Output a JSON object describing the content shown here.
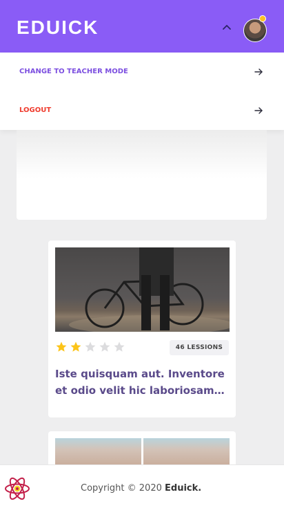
{
  "header": {
    "brand": "EDUICK",
    "brand_color": "#8a5cf6"
  },
  "menu": {
    "items": [
      {
        "label": "CHANGE TO TEACHER MODE",
        "color": "#7c4fe0",
        "icon": "arrow-right-icon"
      },
      {
        "label": "LOGOUT",
        "color": "#ef3b2d",
        "icon": "arrow-right-icon"
      }
    ]
  },
  "course": {
    "rating": 2,
    "rating_max": 5,
    "lessons": "46 LESSIONS",
    "title": "Iste quisquam aut. Inventore et odio velit hic laboriosam…"
  },
  "footer": {
    "copyright_prefix": "Copyright © 2020 ",
    "brand": "Eduick."
  }
}
